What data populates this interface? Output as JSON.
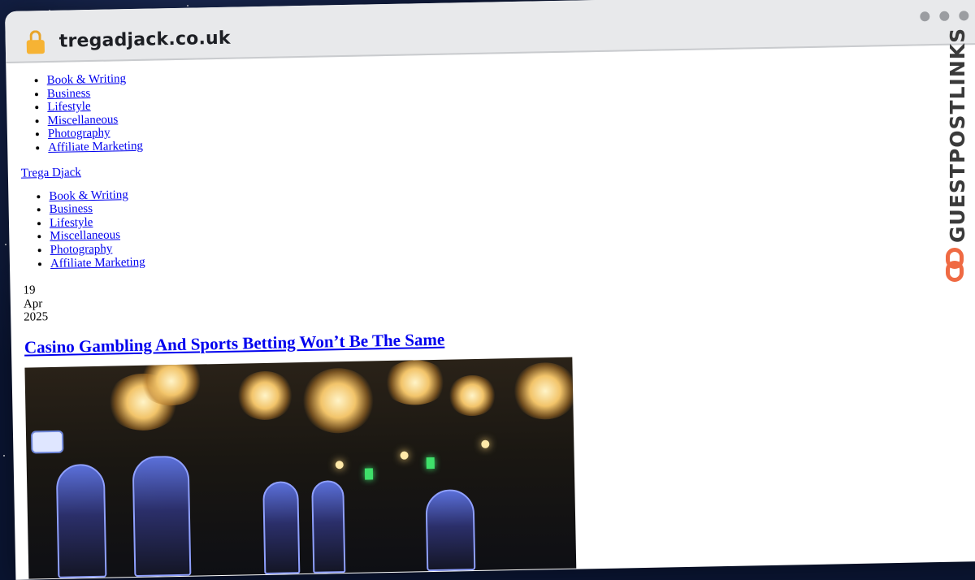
{
  "browser": {
    "url": "tregadjack.co.uk"
  },
  "nav_primary": [
    {
      "label": "Book & Writing"
    },
    {
      "label": "Business"
    },
    {
      "label": "Lifestyle"
    },
    {
      "label": "Miscellaneous"
    },
    {
      "label": "Photography"
    },
    {
      "label": "Affiliate Marketing"
    }
  ],
  "brand": {
    "label": "Trega Djack"
  },
  "nav_secondary": [
    {
      "label": "Book & Writing"
    },
    {
      "label": "Business"
    },
    {
      "label": "Lifestyle"
    },
    {
      "label": "Miscellaneous"
    },
    {
      "label": "Photography"
    },
    {
      "label": "Affiliate Marketing"
    }
  ],
  "post": {
    "date_day": "19",
    "date_month": "Apr",
    "date_year": "2025",
    "title": "Casino Gambling And Sports Betting Won’t Be The Same"
  },
  "watermark": {
    "text": "GUESTPOSTLINKS"
  },
  "colors": {
    "link": "#0000ee",
    "lock": "#f6b334",
    "watermark_accent": "#ef6a43"
  },
  "icons": {
    "lock": "padlock-icon",
    "window_controls": "window-dots-icon"
  }
}
